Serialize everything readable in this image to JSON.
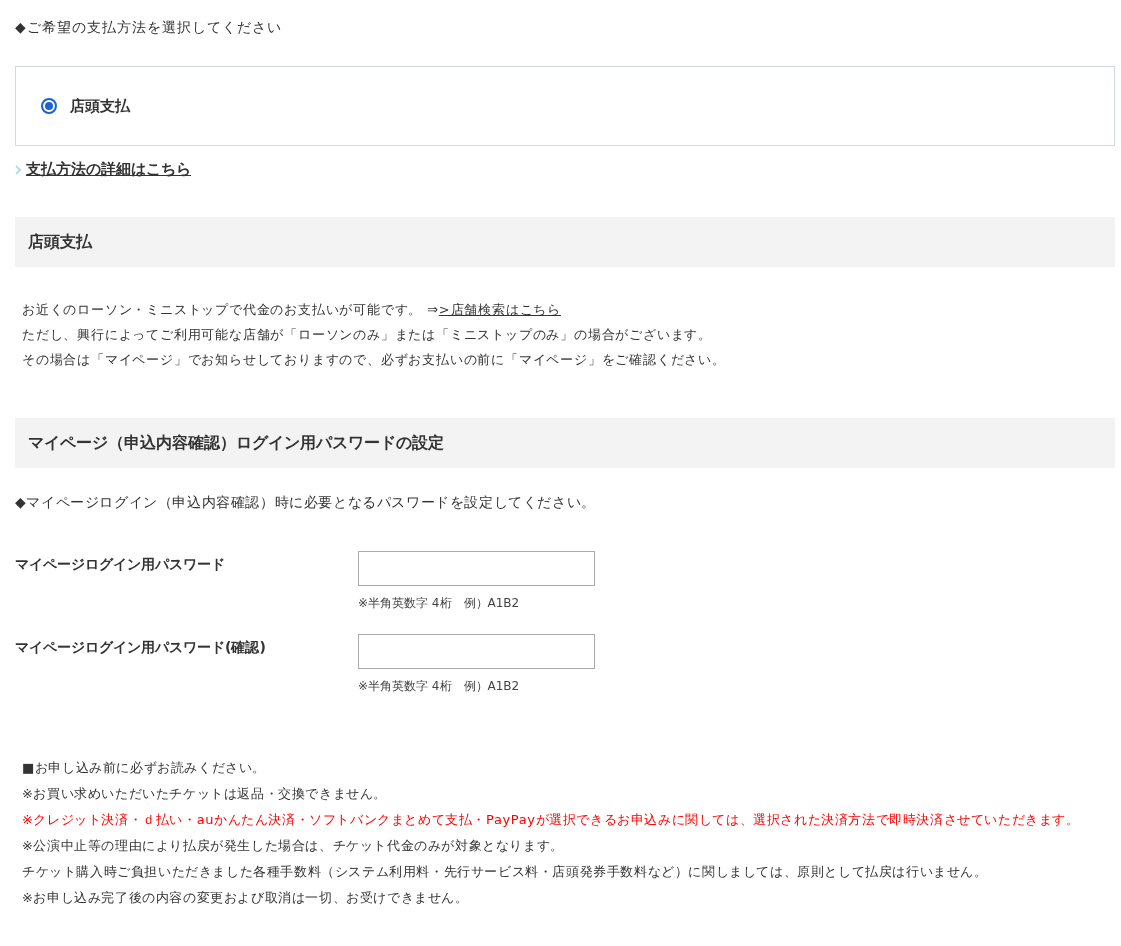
{
  "payment_prompt": "◆ご希望の支払方法を選択してください",
  "payment_options": [
    {
      "label": "店頭支払",
      "selected": true
    }
  ],
  "details_link": "支払方法の詳細はこちら",
  "store_section": {
    "heading": "店頭支払",
    "lines": [
      {
        "text": "お近くのローソン・ミニストップで代金のお支払いが可能です。 ⇒",
        "link": ">店舗検索はこちら"
      },
      {
        "text": "ただし、興行によってご利用可能な店舗が「ローソンのみ」または「ミニストップのみ」の場合がございます。"
      },
      {
        "text": "その場合は「マイページ」でお知らせしておりますので、必ずお支払いの前に「マイページ」をご確認ください。"
      }
    ]
  },
  "password_section": {
    "heading": "マイページ（申込内容確認）ログイン用パスワードの設定",
    "instruction": "◆マイページログイン（申込内容確認）時に必要となるパスワードを設定してください。",
    "fields": [
      {
        "label": "マイページログイン用パスワード",
        "hint": "※半角英数字 4桁　例）A1B2"
      },
      {
        "label": "マイページログイン用パスワード(確認)",
        "hint": "※半角英数字 4桁　例）A1B2"
      }
    ]
  },
  "notices": [
    {
      "kind": "normal",
      "text": "■お申し込み前に必ずお読みください。"
    },
    {
      "kind": "normal",
      "text": "※お買い求めいただいたチケットは返品・交換できません。"
    },
    {
      "kind": "warning",
      "text": "※クレジット決済・ｄ払い・auかんたん決済・ソフトバンクまとめて支払・PayPayが選択できるお申込みに関しては、選択された決済方法で即時決済させていただきます。"
    },
    {
      "kind": "normal",
      "text": "※公演中止等の理由により払戻が発生した場合は、チケット代金のみが対象となります。"
    },
    {
      "kind": "normal",
      "text": "チケット購入時ご負担いただきました各種手数料（システム利用料・先行サービス料・店頭発券手数料など）に関しましては、原則として払戻は行いません。"
    },
    {
      "kind": "normal",
      "text": "※お申し込み完了後の内容の変更および取消は一切、お受けできません。"
    }
  ]
}
